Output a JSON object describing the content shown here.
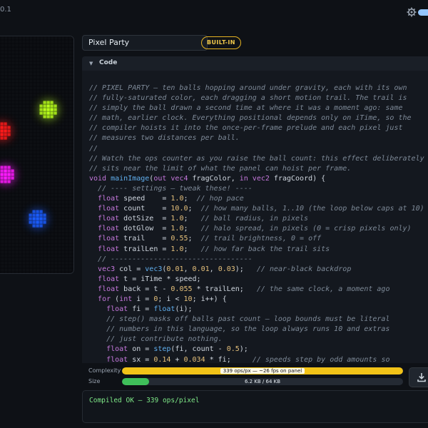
{
  "app": {
    "version": "0.1"
  },
  "preview": {
    "balls": [
      {
        "color": "#b8ff1a"
      },
      {
        "color": "#ff1a1a"
      },
      {
        "color": "#ff1aff"
      },
      {
        "color": "#1a5cff"
      }
    ]
  },
  "editor": {
    "title_value": "Pixel Party",
    "badge": "BUILT-IN",
    "section_label": "Code"
  },
  "code_lines": [
    [
      [
        "c",
        "// PIXEL PARTY — ten balls hopping around under gravity, each with its own"
      ]
    ],
    [
      [
        "c",
        "// fully-saturated color, each dragging a short motion trail. The trail is"
      ]
    ],
    [
      [
        "c",
        "// simply the ball drawn a second time at where it was a moment ago: same"
      ]
    ],
    [
      [
        "c",
        "// math, earlier clock. Everything positional depends only on iTime, so the"
      ]
    ],
    [
      [
        "c",
        "// compiler hoists it into the once-per-frame prelude and each pixel just"
      ]
    ],
    [
      [
        "c",
        "// measures two distances per ball."
      ]
    ],
    [
      [
        "c",
        "//"
      ]
    ],
    [
      [
        "c",
        "// Watch the ops counter as you raise the ball count: this effect deliberately"
      ]
    ],
    [
      [
        "c",
        "// sits near the limit of what the panel can hoist per frame."
      ]
    ],
    [
      [
        "k",
        "void "
      ],
      [
        "f",
        "mainImage"
      ],
      [
        "t",
        "("
      ],
      [
        "k",
        "out vec4 "
      ],
      [
        "t",
        "fragColor, "
      ],
      [
        "k",
        "in vec2 "
      ],
      [
        "t",
        "fragCoord) {"
      ]
    ],
    [
      [
        "t",
        "  "
      ],
      [
        "c",
        "// ---- settings — tweak these! ----"
      ]
    ],
    [
      [
        "t",
        "  "
      ],
      [
        "k",
        "float "
      ],
      [
        "t",
        "speed    = "
      ],
      [
        "n",
        "1.0"
      ],
      [
        "t",
        ";  "
      ],
      [
        "c",
        "// hop pace"
      ]
    ],
    [
      [
        "t",
        "  "
      ],
      [
        "k",
        "float "
      ],
      [
        "t",
        "count    = "
      ],
      [
        "n",
        "10.0"
      ],
      [
        "t",
        ";  "
      ],
      [
        "c",
        "// how many balls, 1..10 (the loop below caps at 10)"
      ]
    ],
    [
      [
        "t",
        "  "
      ],
      [
        "k",
        "float "
      ],
      [
        "t",
        "dotSize  = "
      ],
      [
        "n",
        "1.0"
      ],
      [
        "t",
        ";   "
      ],
      [
        "c",
        "// ball radius, in pixels"
      ]
    ],
    [
      [
        "t",
        "  "
      ],
      [
        "k",
        "float "
      ],
      [
        "t",
        "dotGlow  = "
      ],
      [
        "n",
        "1.0"
      ],
      [
        "t",
        ";   "
      ],
      [
        "c",
        "// halo spread, in pixels (0 = crisp pixels only)"
      ]
    ],
    [
      [
        "t",
        "  "
      ],
      [
        "k",
        "float "
      ],
      [
        "t",
        "trail    = "
      ],
      [
        "n",
        "0.55"
      ],
      [
        "t",
        ";  "
      ],
      [
        "c",
        "// trail brightness, 0 = off"
      ]
    ],
    [
      [
        "t",
        "  "
      ],
      [
        "k",
        "float "
      ],
      [
        "t",
        "trailLen = "
      ],
      [
        "n",
        "1.0"
      ],
      [
        "t",
        ";   "
      ],
      [
        "c",
        "// how far back the trail sits"
      ]
    ],
    [
      [
        "t",
        "  "
      ],
      [
        "c",
        "// ---------------------------------"
      ]
    ],
    [
      [
        "t",
        "  "
      ],
      [
        "k",
        "vec3 "
      ],
      [
        "t",
        "col = "
      ],
      [
        "f",
        "vec3"
      ],
      [
        "t",
        "("
      ],
      [
        "n",
        "0.01"
      ],
      [
        "t",
        ", "
      ],
      [
        "n",
        "0.01"
      ],
      [
        "t",
        ", "
      ],
      [
        "n",
        "0.03"
      ],
      [
        "t",
        ");   "
      ],
      [
        "c",
        "// near-black backdrop"
      ]
    ],
    [
      [
        "t",
        "  "
      ],
      [
        "k",
        "float "
      ],
      [
        "t",
        "t = iTime * speed;"
      ]
    ],
    [
      [
        "t",
        "  "
      ],
      [
        "k",
        "float "
      ],
      [
        "t",
        "back = t - "
      ],
      [
        "n",
        "0.055"
      ],
      [
        "t",
        " * trailLen;   "
      ],
      [
        "c",
        "// the same clock, a moment ago"
      ]
    ],
    [
      [
        "t",
        "  "
      ],
      [
        "k",
        "for "
      ],
      [
        "t",
        "("
      ],
      [
        "k",
        "int "
      ],
      [
        "t",
        "i = "
      ],
      [
        "n",
        "0"
      ],
      [
        "t",
        "; i < "
      ],
      [
        "n",
        "10"
      ],
      [
        "t",
        "; i++) {"
      ]
    ],
    [
      [
        "t",
        "    "
      ],
      [
        "k",
        "float "
      ],
      [
        "t",
        "fi = "
      ],
      [
        "f",
        "float"
      ],
      [
        "t",
        "(i);"
      ]
    ],
    [
      [
        "t",
        "    "
      ],
      [
        "c",
        "// step() masks off balls past count — loop bounds must be literal"
      ]
    ],
    [
      [
        "t",
        "    "
      ],
      [
        "c",
        "// numbers in this language, so the loop always runs 10 and extras"
      ]
    ],
    [
      [
        "t",
        "    "
      ],
      [
        "c",
        "// just contribute nothing."
      ]
    ],
    [
      [
        "t",
        "    "
      ],
      [
        "k",
        "float "
      ],
      [
        "t",
        "on = "
      ],
      [
        "f",
        "step"
      ],
      [
        "t",
        "(fi, count - "
      ],
      [
        "n",
        "0.5"
      ],
      [
        "t",
        ");"
      ]
    ],
    [
      [
        "t",
        "    "
      ],
      [
        "k",
        "float "
      ],
      [
        "t",
        "sx = "
      ],
      [
        "n",
        "0.14"
      ],
      [
        "t",
        " + "
      ],
      [
        "n",
        "0.034"
      ],
      [
        "t",
        " * fi;     "
      ],
      [
        "c",
        "// speeds step by odd amounts so"
      ]
    ]
  ],
  "meters": {
    "complexity_label": "Complexity",
    "complexity_text": "339 ops/px — ~26 fps on panel",
    "complexity_fraction": 1.0,
    "complexity_color": "#f2c318",
    "size_label": "Size",
    "size_text": "6.2 KB / 64 KB",
    "size_fraction": 0.097,
    "size_color": "#3fbf5a"
  },
  "status": {
    "message": "Compiled OK — 339 ops/pixel"
  }
}
